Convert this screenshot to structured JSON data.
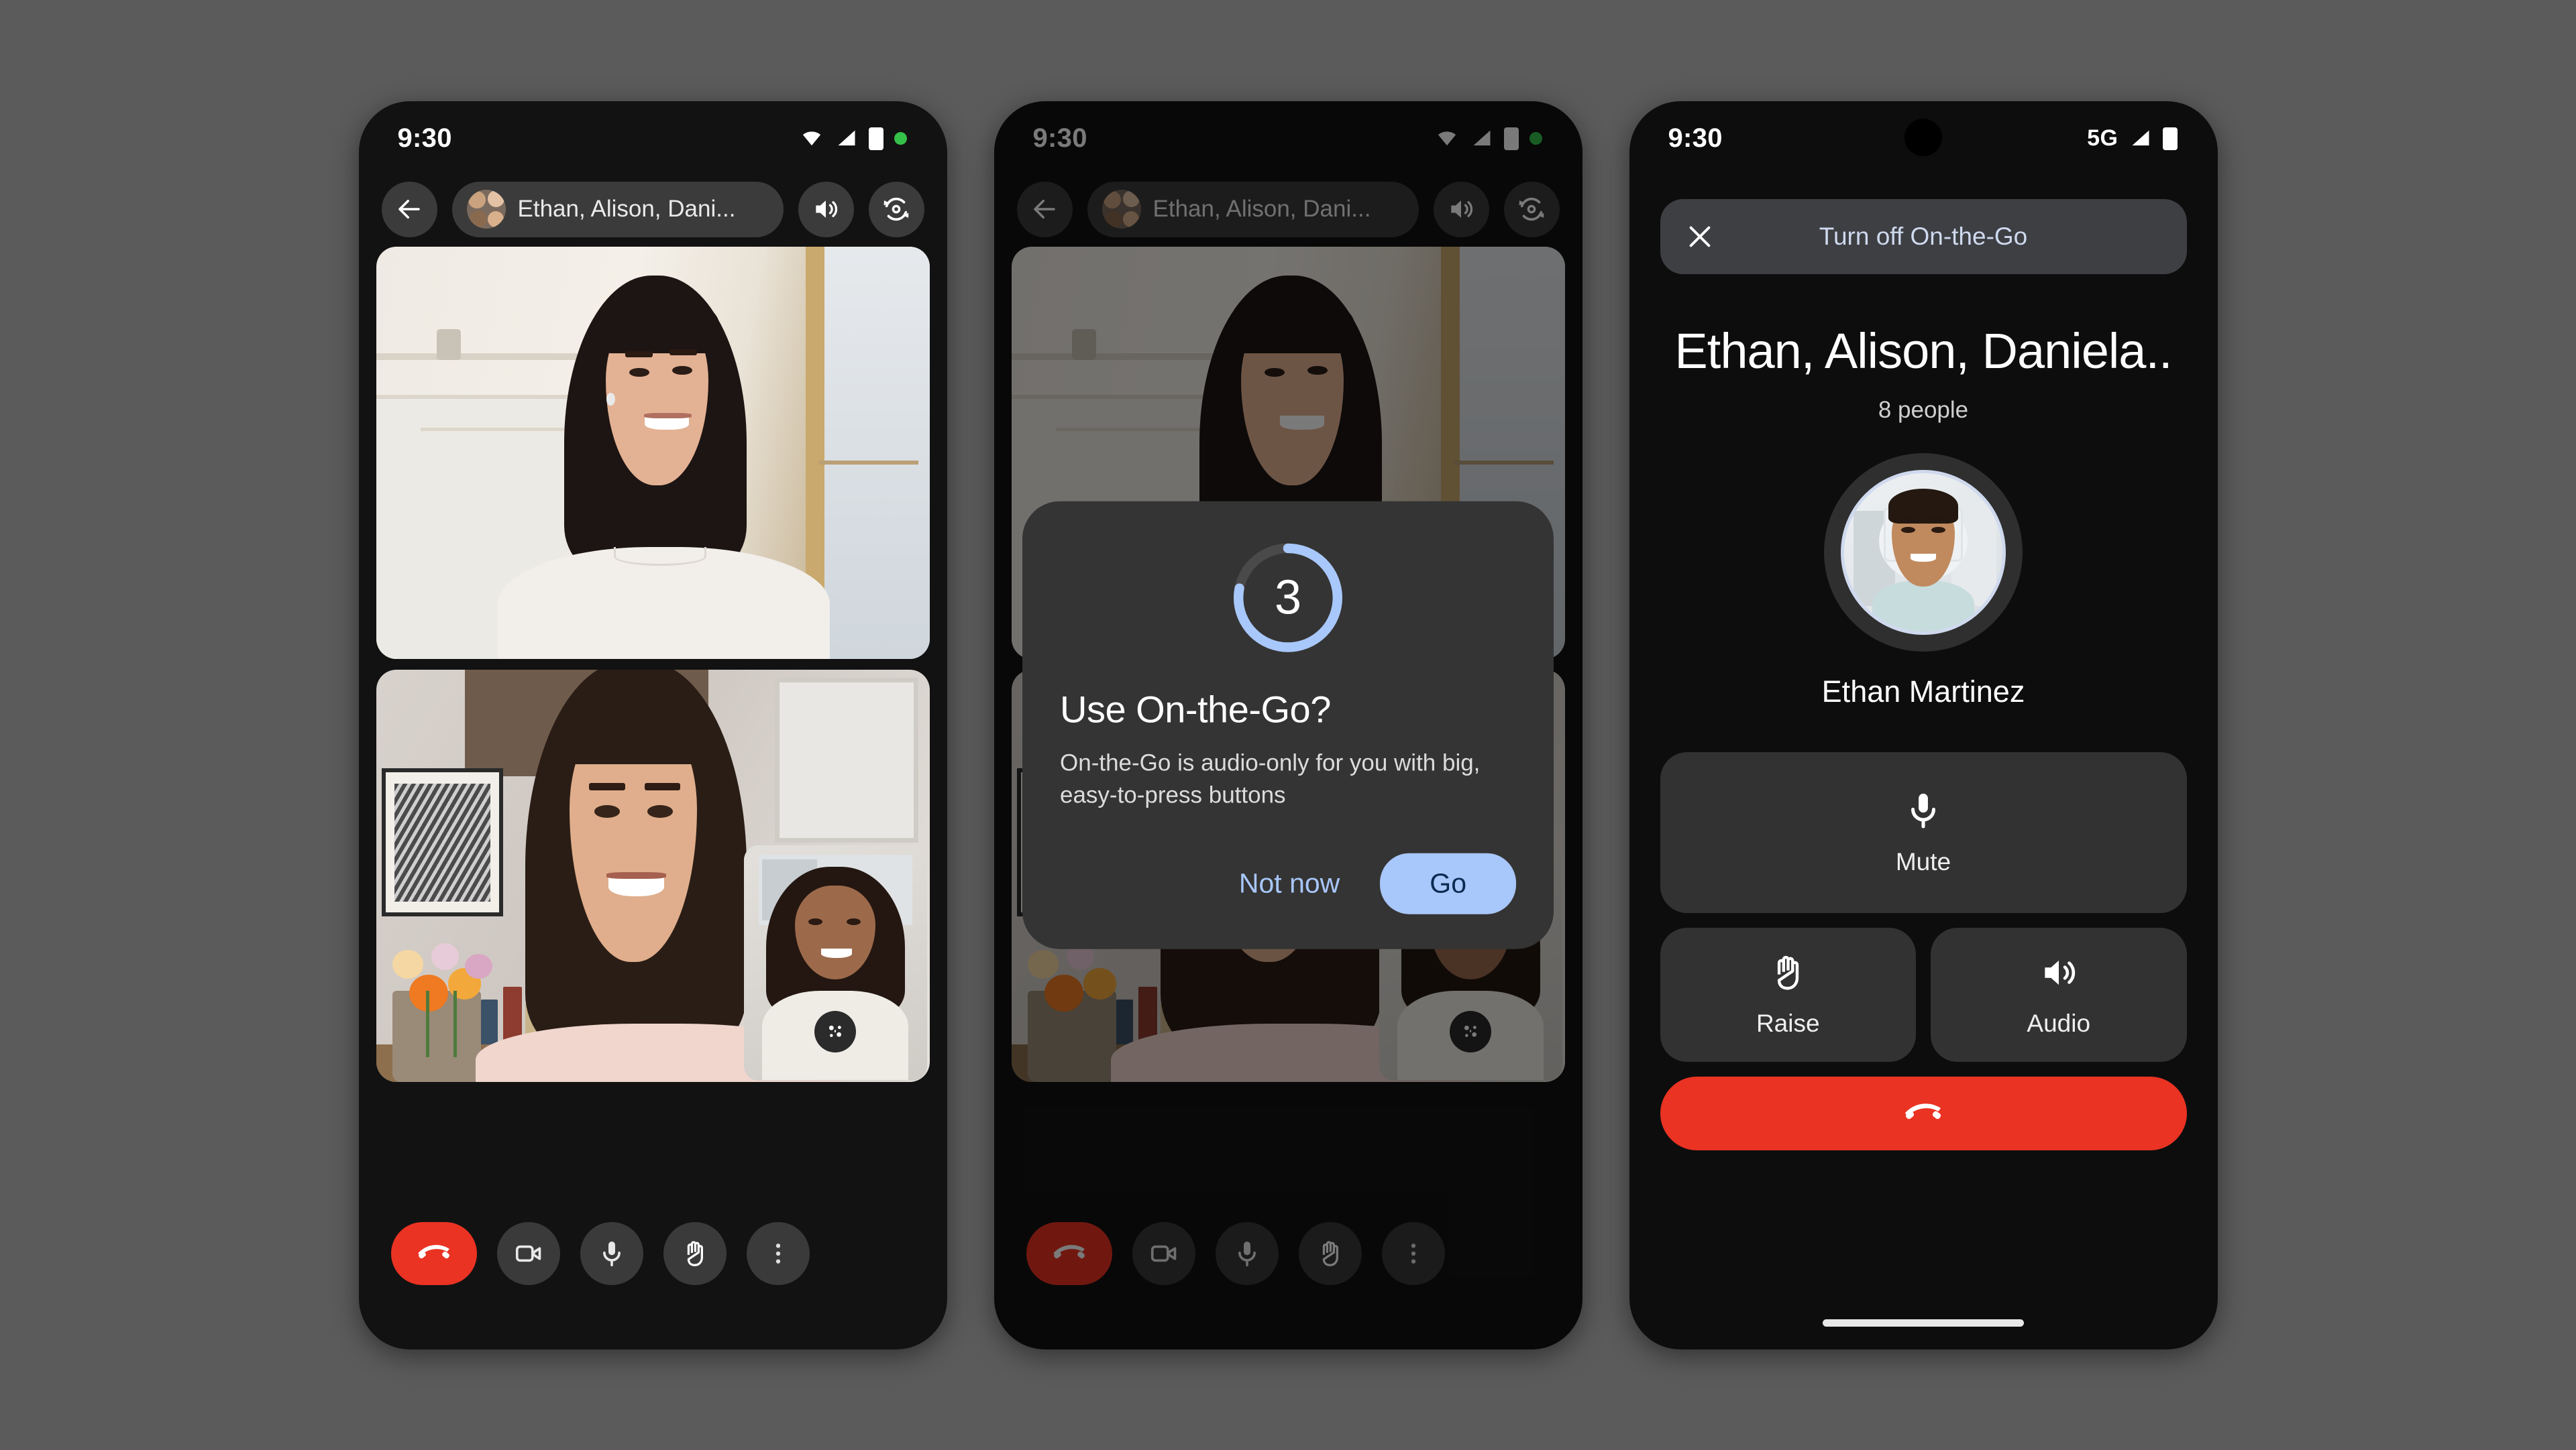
{
  "background_color": "#5b5b5b",
  "accent": {
    "blue": "#a8c7fa",
    "red": "#ea3323",
    "surface": "#343434",
    "dark": "#121212"
  },
  "phones": [
    {
      "id": "phone-video-call",
      "status_bar": {
        "time": "9:30",
        "icons": [
          "wifi-icon",
          "signal-icon",
          "battery-icon",
          "recording-dot-icon"
        ]
      },
      "header": {
        "back_label": "back-arrow-icon",
        "participants_title": "Ethan, Alison, Dani...",
        "speaker_label": "speaker-icon",
        "flip_camera_label": "flip-camera-icon"
      },
      "tiles": [
        {
          "name": "remote-participant-1"
        },
        {
          "name": "remote-participant-2",
          "pip": "self-view"
        }
      ],
      "controls": [
        {
          "name": "end-call",
          "icon": "end-call-icon"
        },
        {
          "name": "camera",
          "icon": "video-camera-icon"
        },
        {
          "name": "microphone",
          "icon": "microphone-icon"
        },
        {
          "name": "raise-hand",
          "icon": "raise-hand-icon"
        },
        {
          "name": "more-options",
          "icon": "more-vertical-icon"
        }
      ]
    },
    {
      "id": "phone-on-the-go-prompt",
      "status_bar": {
        "time": "9:30"
      },
      "header": {
        "participants_title": "Ethan, Alison, Dani..."
      },
      "dialog": {
        "countdown": "3",
        "countdown_progress_percent": 78,
        "title": "Use On-the-Go?",
        "body": "On-the-Go is audio-only for you with big, easy-to-press buttons",
        "secondary_label": "Not now",
        "primary_label": "Go"
      }
    },
    {
      "id": "phone-on-the-go-active",
      "status_bar": {
        "time": "9:30",
        "network": "5G"
      },
      "banner": {
        "close_icon": "close-icon",
        "label": "Turn off On-the-Go"
      },
      "call_title": "Ethan, Alison, Daniela..",
      "people_count": "8 people",
      "active_speaker": {
        "name": "Ethan Martinez"
      },
      "buttons": [
        {
          "name": "mute",
          "label": "Mute",
          "icon": "microphone-icon"
        },
        {
          "name": "raise",
          "label": "Raise",
          "icon": "raise-hand-icon"
        },
        {
          "name": "audio",
          "label": "Audio",
          "icon": "speaker-icon"
        }
      ],
      "end_call": {
        "name": "end-call",
        "icon": "end-call-icon"
      }
    }
  ]
}
